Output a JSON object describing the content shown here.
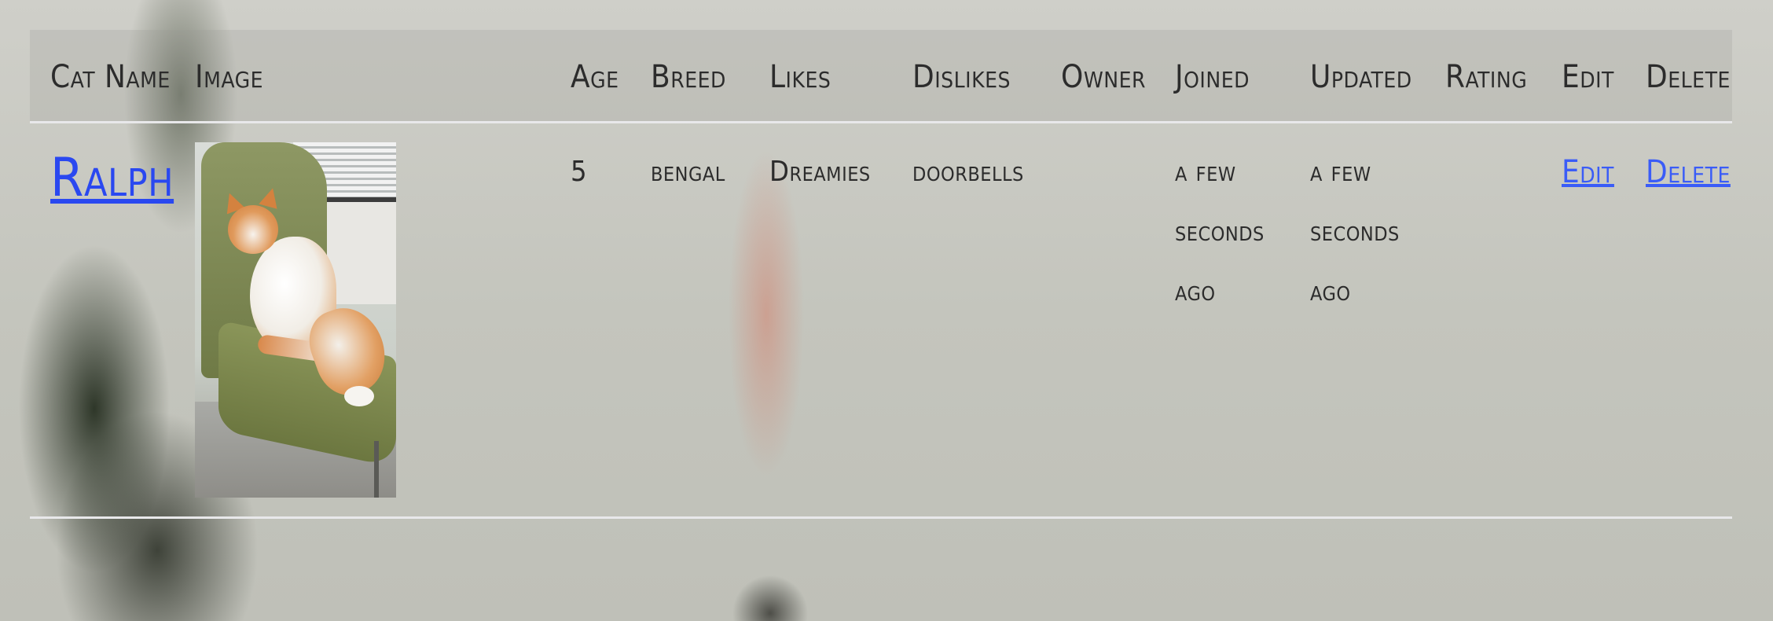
{
  "table": {
    "headers": {
      "cat_name": "Cat Name",
      "image": "Image",
      "age": "Age",
      "breed": "Breed",
      "likes": "Likes",
      "dislikes": "Dislikes",
      "owner": "Owner",
      "joined": "Joined",
      "updated": "Updated",
      "rating": "Rating",
      "edit": "Edit",
      "delete": "Delete"
    },
    "rows": [
      {
        "cat_name": "Ralph",
        "age": "5",
        "breed": "bengal",
        "likes": "Dreamies",
        "dislikes": "doorbells",
        "owner": "",
        "joined": "a few seconds ago",
        "updated": "a few seconds ago",
        "rating": "",
        "edit_label": "Edit",
        "delete_label": "Delete"
      }
    ]
  },
  "colors": {
    "link": "#2a48f0",
    "text": "#2c2c2c",
    "divider": "#e8e8ea"
  }
}
